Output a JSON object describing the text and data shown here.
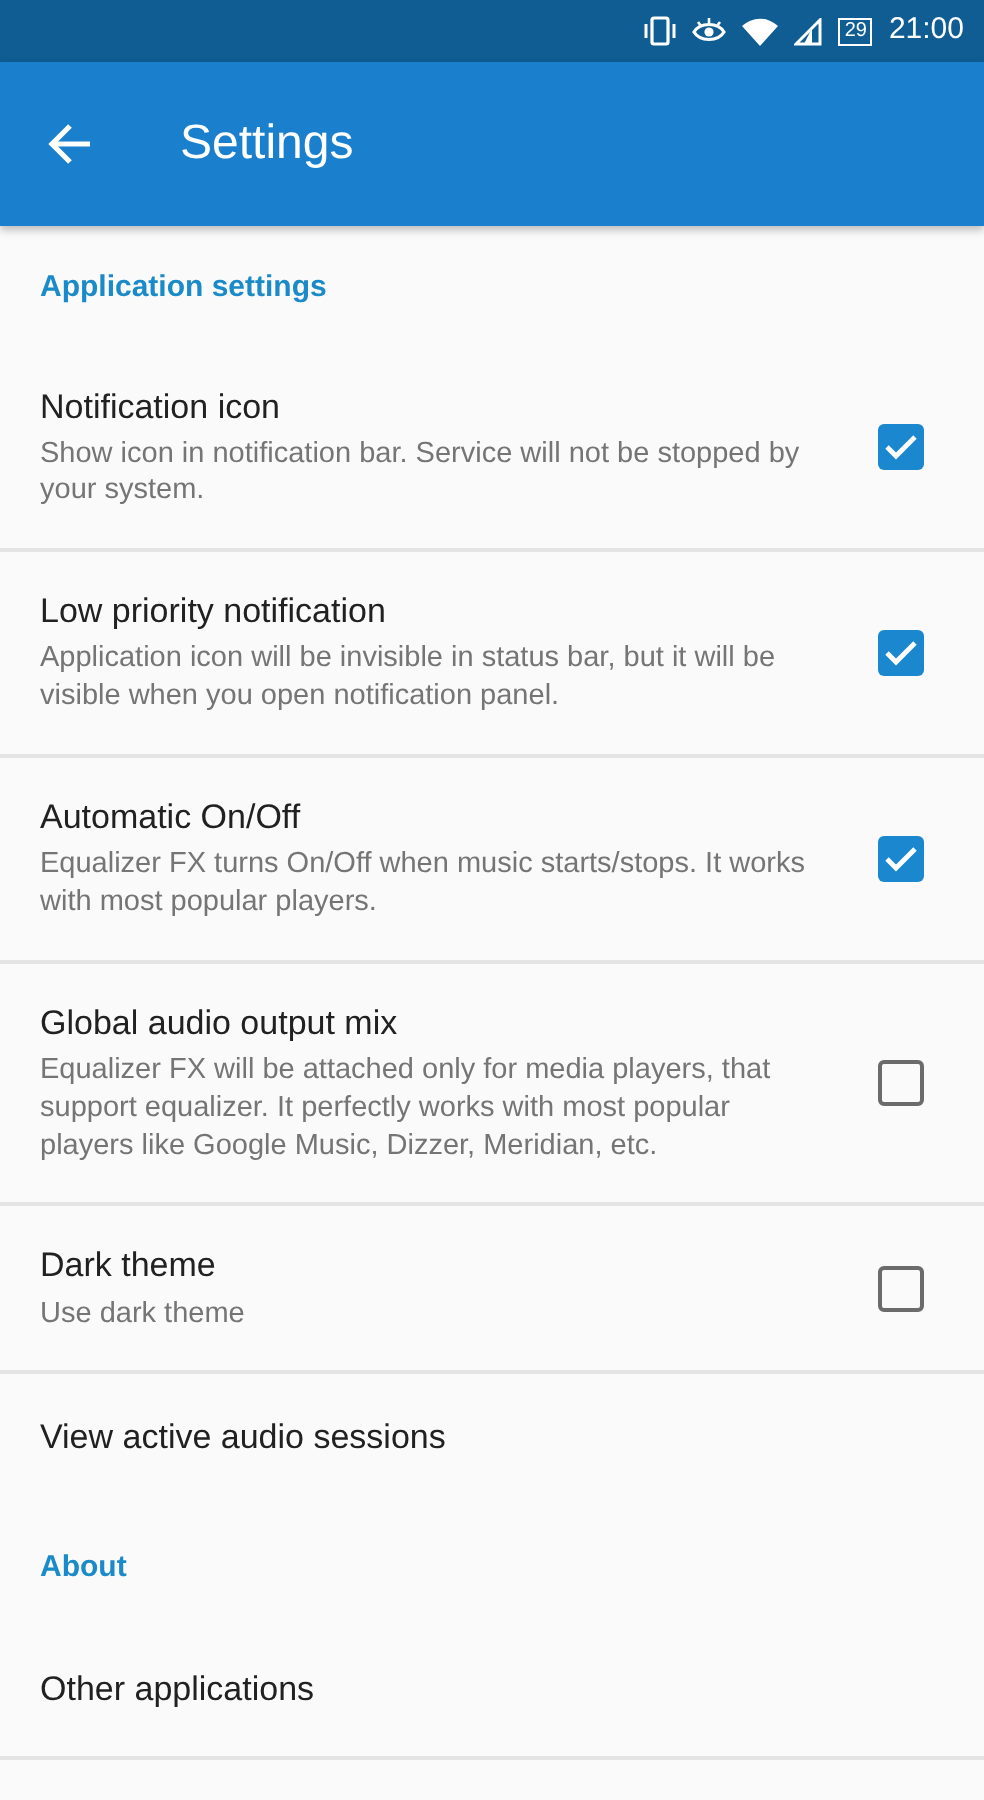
{
  "status_bar": {
    "battery": "29",
    "time": "21:00"
  },
  "app_bar": {
    "title": "Settings"
  },
  "sections": [
    {
      "header": "Application settings",
      "items": [
        {
          "kind": "checkbox",
          "title": "Notification icon",
          "summary": "Show icon in notification bar. Service will not be stopped by your system.",
          "checked": true
        },
        {
          "kind": "checkbox",
          "title": "Low priority notification",
          "summary": "Application icon will be invisible in status bar, but it will be visible when you open notification panel.",
          "checked": true
        },
        {
          "kind": "checkbox",
          "title": "Automatic On/Off",
          "summary": "Equalizer FX turns On/Off when music starts/stops. It works with most popular players.",
          "checked": true
        },
        {
          "kind": "checkbox",
          "title": "Global audio output mix",
          "summary": "Equalizer FX will be attached only for media players, that support equalizer. It perfectly works with most popular players like Google Music, Dizzer, Meridian, etc.",
          "checked": false
        },
        {
          "kind": "checkbox",
          "title": "Dark theme",
          "summary": "Use dark theme",
          "checked": false
        },
        {
          "kind": "plain",
          "title": "View active audio sessions"
        }
      ]
    },
    {
      "header": "About",
      "items": [
        {
          "kind": "plain",
          "title": "Other applications"
        }
      ]
    }
  ]
}
